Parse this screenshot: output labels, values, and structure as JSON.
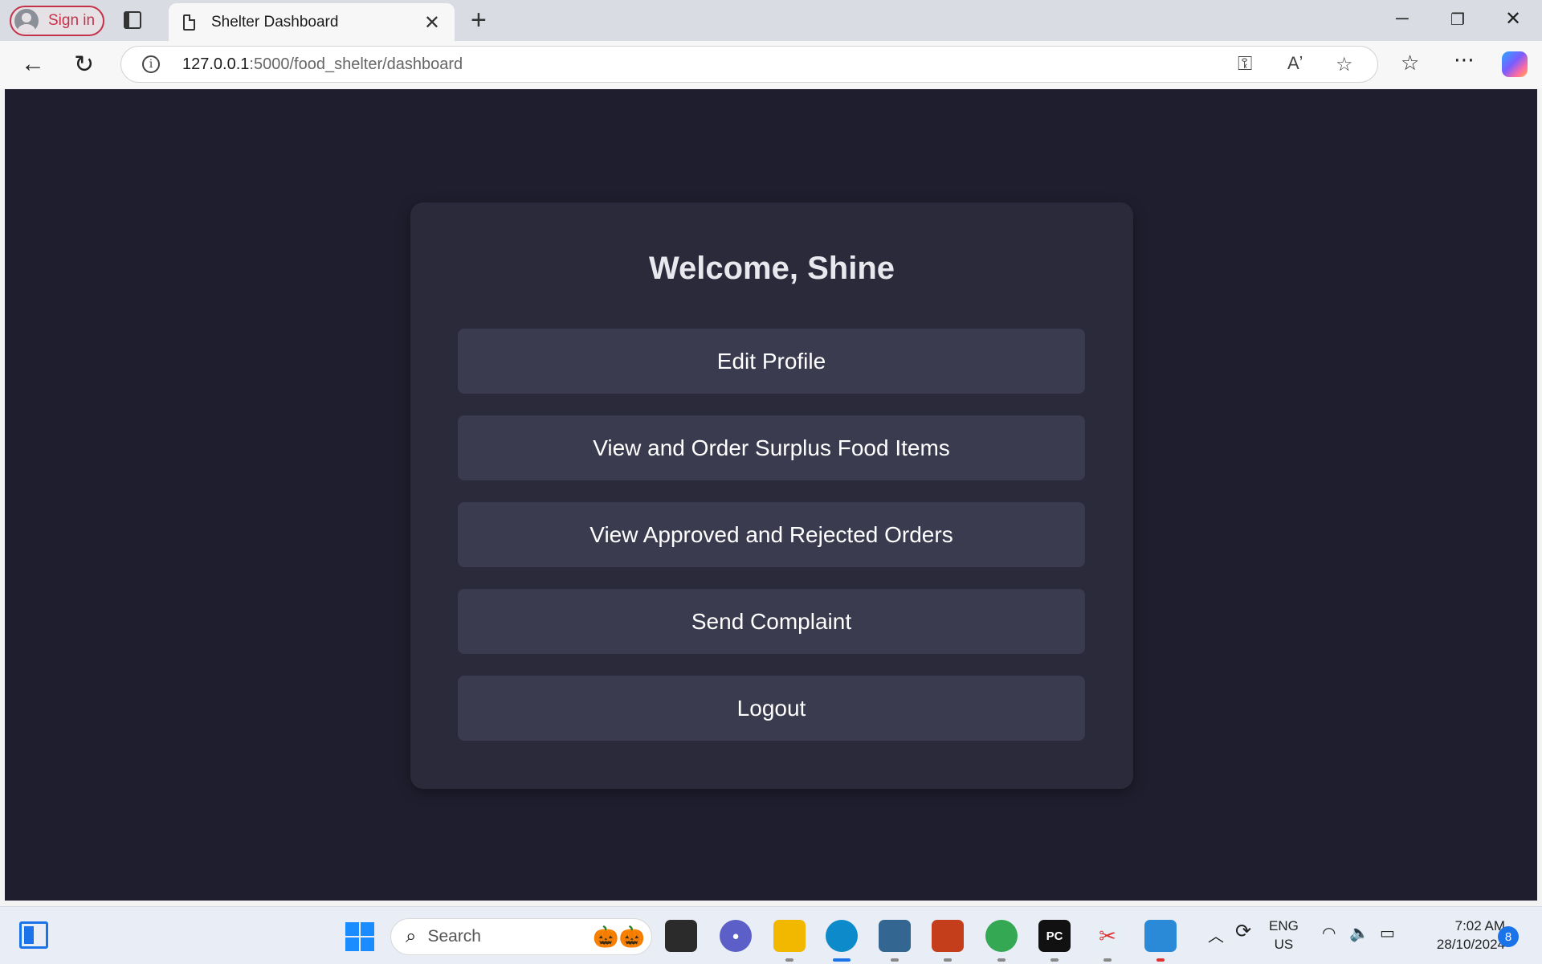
{
  "browser": {
    "signin_label": "Sign in",
    "tab_title": "Shelter Dashboard",
    "url_host": "127.0.0.1",
    "url_path": ":5000/food_shelter/dashboard"
  },
  "page": {
    "welcome": "Welcome, Shine",
    "buttons": [
      "Edit Profile",
      "View and Order Surplus Food Items",
      "View Approved and Rejected Orders",
      "Send Complaint",
      "Logout"
    ]
  },
  "taskbar": {
    "search_placeholder": "Search",
    "lang_line1": "ENG",
    "lang_line2": "US",
    "time": "7:02 AM",
    "date": "28/10/2024",
    "notification_count": "8"
  },
  "colors": {
    "page_bg": "#1e1e2e",
    "card_bg": "#2a2a3b",
    "button_bg": "#3b3b50",
    "signin_accent": "#c4314b"
  }
}
